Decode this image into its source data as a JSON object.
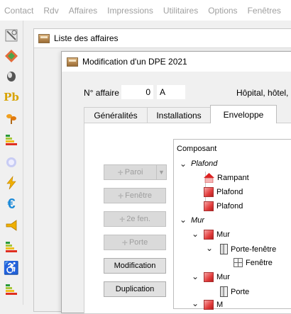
{
  "menu": [
    "Contact",
    "Rdv",
    "Affaires",
    "Impressions",
    "Utilitaires",
    "Options",
    "Fenêtres"
  ],
  "toolbar_icons": [
    "tools-icon",
    "diamond-icon",
    "gloves-icon",
    "lead-pb-icon",
    "plant-icon",
    "energy-label-icon",
    "gas-icon",
    "lightning-icon",
    "euro-icon",
    "megaphone-icon",
    "energy-label-icon-2",
    "wheelchair-icon",
    "energy-label-icon-3"
  ],
  "toolbar_text": {
    "pb": "Pb",
    "euro": "€",
    "wheelchair": "♿"
  },
  "outer_window": {
    "title": "Liste des affaires"
  },
  "dialog": {
    "title": "Modification d'un DPE 2021",
    "affaire_label": "N° affaire",
    "affaire_number": "0",
    "affaire_letter": "A",
    "building_type": "Hôpital, hôtel, in"
  },
  "tabs": [
    {
      "label": "Généralités",
      "active": false
    },
    {
      "label": "Installations",
      "active": false
    },
    {
      "label": "Enveloppe",
      "active": true
    }
  ],
  "buttons": {
    "paroi": "Paroi",
    "fenetre": "Fenêtre",
    "second_fen": "2e fen.",
    "porte": "Porte",
    "modification": "Modification",
    "duplication": "Duplication"
  },
  "tree": {
    "header": "Composant",
    "items": [
      {
        "text": "Plafond",
        "type": "category"
      },
      {
        "text": "Rampant",
        "type": "house"
      },
      {
        "text": "Plafond",
        "type": "cube"
      },
      {
        "text": "Plafond",
        "type": "cube"
      },
      {
        "text": "Mur",
        "type": "category"
      },
      {
        "text": "Mur",
        "type": "cube"
      },
      {
        "text": "Porte-fenêtre",
        "type": "door"
      },
      {
        "text": "Fenêtre",
        "type": "window"
      },
      {
        "text": "Mur",
        "type": "cube"
      },
      {
        "text": "Porte",
        "type": "door"
      },
      {
        "text": "M",
        "type": "cube"
      }
    ]
  }
}
